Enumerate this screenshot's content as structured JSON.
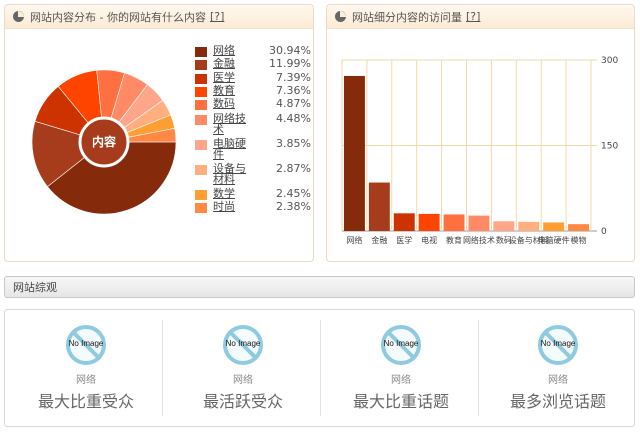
{
  "pie_panel": {
    "title": "网站内容分布 - 你的网站有什么内容",
    "help": "[?]",
    "center_label": "内容"
  },
  "bar_panel": {
    "title": "网站细分内容的访问量",
    "help": "[?]"
  },
  "legend": [
    {
      "name": "网络",
      "pct": "30.94%",
      "color": "#862a0c"
    },
    {
      "name": "金融",
      "pct": "11.99%",
      "color": "#a63c1c"
    },
    {
      "name": "医学",
      "pct": "7.39%",
      "color": "#cc3300"
    },
    {
      "name": "教育",
      "pct": "7.36%",
      "color": "#ff4400"
    },
    {
      "name": "数码",
      "pct": "4.87%",
      "color": "#ff7040"
    },
    {
      "name": "网络技术",
      "pct": "4.48%",
      "color": "#ff8a65"
    },
    {
      "name": "电脑硬件",
      "pct": "3.85%",
      "color": "#ffa68a"
    },
    {
      "name": "设备与材料",
      "pct": "2.87%",
      "color": "#ffae80"
    },
    {
      "name": "数学",
      "pct": "2.45%",
      "color": "#ff9f33"
    },
    {
      "name": "时尚",
      "pct": "2.38%",
      "color": "#ff8844"
    }
  ],
  "chart_data": [
    {
      "type": "pie",
      "title": "",
      "categories": [
        "网络",
        "金融",
        "医学",
        "教育",
        "数码",
        "网络技术",
        "电脑硬件",
        "设备与材料",
        "数学",
        "时尚"
      ],
      "values": [
        30.94,
        11.99,
        7.39,
        7.36,
        4.87,
        4.48,
        3.85,
        2.87,
        2.45,
        2.38
      ],
      "colors": [
        "#862a0c",
        "#a63c1c",
        "#cc3300",
        "#ff4400",
        "#ff7040",
        "#ff8a65",
        "#ffa68a",
        "#ffae80",
        "#ff9f33",
        "#ff8844"
      ],
      "legend": "right"
    },
    {
      "type": "bar",
      "title": "",
      "categories": [
        "网络",
        "金融",
        "医学",
        "电视",
        "教育",
        "网络技术",
        "数码",
        "设备与材料",
        "电脑硬件",
        "模物"
      ],
      "values": [
        272,
        85,
        31,
        30,
        29,
        27,
        17,
        16,
        15,
        12
      ],
      "colors": [
        "#862a0c",
        "#a63c1c",
        "#cc3300",
        "#ff4400",
        "#ff7040",
        "#ff8a65",
        "#ffa68a",
        "#ffae80",
        "#ff9f33",
        "#ff8844"
      ],
      "ylim": [
        0,
        300
      ],
      "yticks": [
        "0",
        "150",
        "300"
      ],
      "grid": true,
      "yaxis_side": "right"
    }
  ],
  "overview": {
    "title": "网站综观",
    "noimage": "No Image",
    "cards": [
      {
        "value": "网络",
        "label": "最大比重受众"
      },
      {
        "value": "网络",
        "label": "最活跃受众"
      },
      {
        "value": "网络",
        "label": "最大比重话题"
      },
      {
        "value": "网络",
        "label": "最多浏览话题"
      }
    ]
  }
}
